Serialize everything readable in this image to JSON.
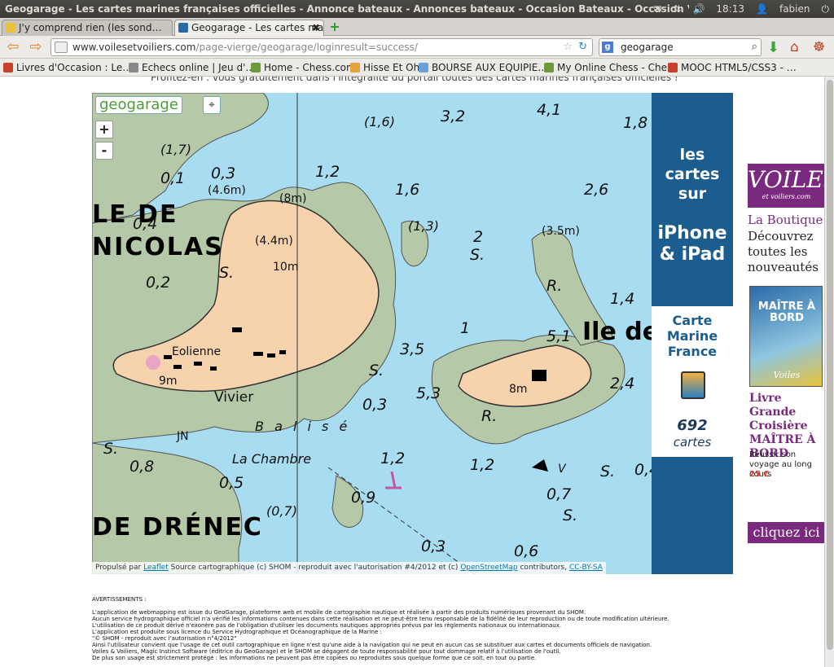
{
  "window": {
    "title": "Geogarage - Les cartes marines françaises officielles - Annonce bateaux - Annonces bateaux - Occasion Bateaux - Occasion Voiliers - Occasion v",
    "time": "18:13",
    "user": "fabien"
  },
  "tabs": [
    {
      "label": "J'y comprend rien (les sond…"
    },
    {
      "label": "Geogarage - Les cartes mari…"
    }
  ],
  "nav": {
    "url_host": "www.voilesetvoiliers.com",
    "url_path": "/page-vierge/geogarage/loginresult=success/",
    "search_value": "geogarage"
  },
  "bookmarks": [
    "Livres d'Occasion : Le…",
    "Echecs online | Jeu d'…",
    "Home - Chess.com",
    "Hisse Et Oh",
    "BOURSE AUX EQUIPIE…",
    "My Online Chess - Che…",
    "MOOC HTML5/CSS3 - …"
  ],
  "page_top_text": "Profitez-en : vous gratuitement dans l'intégralité du portail toutes des cartes marines françaises officielles !",
  "map": {
    "logo": "geogarage",
    "zoom_in": "+",
    "zoom_out": "-",
    "places": {
      "nicolas_le": "LE  DE",
      "nicolas": "NICOLAS",
      "drenec": "DE DRÉNEC",
      "ile": "Ile de",
      "eolienne": "Eolienne",
      "vivier": "Vivier",
      "jn": "JN",
      "chambre": "La  Chambre",
      "balise": "B a l i s é"
    },
    "heights": {
      "h10": "10m",
      "h9": "9m",
      "h8": "8m",
      "h44": "(4.4m)",
      "h46": "(4.6m)",
      "h8p": "(8m)",
      "h35": "(3.5m)"
    },
    "soundings": [
      "3,2",
      "4,1",
      "1,8",
      "(1,6)",
      "(1,7)",
      "0,1",
      "0,3",
      "1,2",
      "1,6",
      "2,6",
      "0,4",
      "(1,3)",
      "2",
      "0,2",
      "1,4",
      "1",
      "5,1",
      "3,5",
      "2,4",
      "0,3",
      "5,3",
      "1,2",
      "1,2",
      "0,8",
      "0,5",
      "(0,7)",
      "0,9",
      "0,7",
      "0,3",
      "0,6",
      "0,4",
      "1",
      "S.",
      "S.",
      "S.",
      "S.",
      "R.",
      "R.",
      "S.",
      "S.",
      "S.",
      "S.",
      "V"
    ],
    "attribution": {
      "prefix": "Propulsé par",
      "leaflet": "Leaflet",
      "source": "Source cartographique (c) SHOM - reproduit avec l'autorisation #4/2012 et (c)",
      "osm": "OpenStreetMap",
      "contrib": "contributors,",
      "license": "CC-BY-SA"
    }
  },
  "promo": {
    "line1": "les cartes sur",
    "line2": "iPhone & iPad",
    "card_title": "Carte Marine France",
    "count": "692",
    "count_label": "cartes"
  },
  "ad": {
    "logo": "VOILES",
    "logo_sub": "et voiliers.com",
    "boutique": "La Boutique",
    "tagline": "Découvrez toutes les nouveautés",
    "book_title": "MAÎTRE À BORD",
    "book_brand": "Voiles",
    "book_name": "Livre Grande Croisière MAÎTRE À BORD",
    "book_desc": "Réussir son voyage au long cours",
    "price": "25 €",
    "cta": "cliquez ici"
  },
  "warnings": {
    "title": "AVERTISSEMENTS :",
    "lines": [
      "L'application de webmapping est issue du GeoGarage, plateforme web et mobile de cartographie nautique et réalisée à partir des produits numériques provenant du SHOM.",
      "Aucun service hydrographique officiel n'a vérifié les informations contenues dans cette réalisation et ne peut-être tenu responsable de la fidélité de leur reproduction ou de toute modification ultérieure.",
      "L'utilisation de ce produit dérivé n'exonère pas de l'obligation d'utiliser les documents nautiques appropriés prévus par les règlements nationaux ou internationaux.",
      "L'application est produite sous licence du Service Hydrographique et Océanographique de la Marine :",
      "\"© SHOM - reproduit avec l'autorisation n°4/2012\"",
      "Ainsi l'utilisateur convient que l'usage de cet outil cartographique en ligne n'est qu'une aide à la navigation qui ne peut en aucun cas se substituer aux cartes et documents officiels de navigation.",
      "Voiles & Voiliers, Magic Instinct Software (éditrice du GeoGarage) et le SHOM se dégagent de toute responsabilité pour tout dommage relatif à l'utilisation de l'outil.",
      "De plus son usage est strictement protégé : les informations ne peuvent pas être copiées ou reproduites sous quelque forme que ce soit, en tout ou partie."
    ]
  },
  "colors": {
    "sea": "#a8dcf0",
    "land": "#f7d3ad",
    "rock": "#b5c9a8",
    "promo": "#1c5d8f",
    "ad": "#7a2a7e"
  }
}
